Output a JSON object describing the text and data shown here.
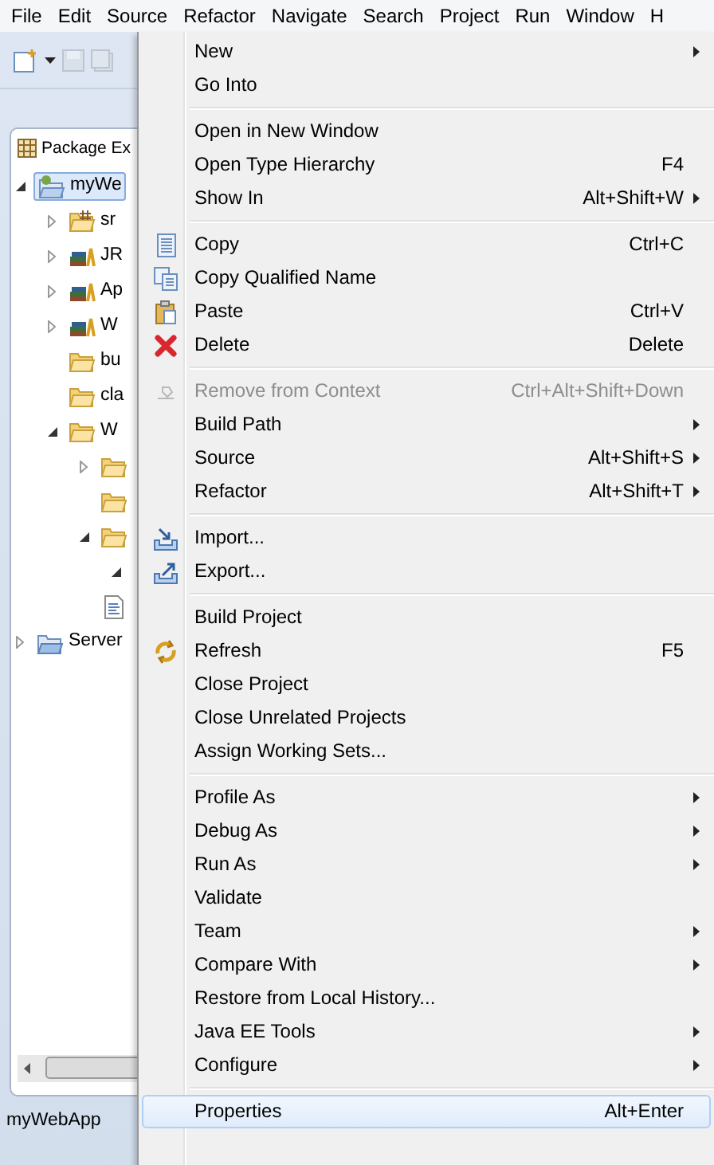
{
  "menubar": [
    "File",
    "Edit",
    "Source",
    "Refactor",
    "Navigate",
    "Search",
    "Project",
    "Run",
    "Window",
    "H"
  ],
  "explorer": {
    "title": "Package Ex",
    "tree": [
      {
        "label": "myWe",
        "kind": "project",
        "expanded": true,
        "selected": true,
        "children": [
          {
            "label": "sr",
            "kind": "package",
            "expanded": false,
            "selected": false
          },
          {
            "label": "JR",
            "kind": "library",
            "expanded": false,
            "selected": false
          },
          {
            "label": "Ap",
            "kind": "library",
            "expanded": false,
            "selected": false
          },
          {
            "label": "W",
            "kind": "library",
            "expanded": false,
            "selected": false
          },
          {
            "label": "bu",
            "kind": "folder",
            "selected": false
          },
          {
            "label": "cla",
            "kind": "folder",
            "selected": false
          },
          {
            "label": "W",
            "kind": "folder",
            "expanded": true,
            "selected": false,
            "children": [
              {
                "kind": "folder",
                "expanded": false,
                "selected": false
              },
              {
                "kind": "folder",
                "selected": false
              },
              {
                "kind": "folder",
                "expanded": true,
                "selected": false,
                "children": [
                  {
                    "expanded": true,
                    "selected": false
                  }
                ]
              },
              {
                "kind": "file",
                "selected": false
              }
            ]
          }
        ]
      },
      {
        "label": "Server",
        "kind": "servers",
        "expanded": false,
        "selected": false
      }
    ]
  },
  "status_bar": "myWebApp",
  "context_menu": [
    [
      {
        "label": "New",
        "submenu": true,
        "selected": false
      },
      {
        "label": "Go Into",
        "selected": false
      }
    ],
    [
      {
        "label": "Open in New Window",
        "selected": false
      },
      {
        "label": "Open Type Hierarchy",
        "shortcut": "F4",
        "selected": false
      },
      {
        "label": "Show In",
        "shortcut": "Alt+Shift+W",
        "submenu": true,
        "selected": false
      }
    ],
    [
      {
        "label": "Copy",
        "shortcut": "Ctrl+C",
        "kind": "copy",
        "selected": false
      },
      {
        "label": "Copy Qualified Name",
        "kind": "copy2",
        "selected": false
      },
      {
        "label": "Paste",
        "shortcut": "Ctrl+V",
        "kind": "paste",
        "selected": false
      },
      {
        "label": "Delete",
        "shortcut": "Delete",
        "kind": "delete",
        "selected": false
      }
    ],
    [
      {
        "label": "Remove from Context",
        "shortcut": "Ctrl+Alt+Shift+Down",
        "kind": "remove",
        "disabled": true,
        "selected": false
      },
      {
        "label": "Build Path",
        "submenu": true,
        "selected": false
      },
      {
        "label": "Source",
        "shortcut": "Alt+Shift+S",
        "submenu": true,
        "selected": false
      },
      {
        "label": "Refactor",
        "shortcut": "Alt+Shift+T",
        "submenu": true,
        "selected": false
      }
    ],
    [
      {
        "label": "Import...",
        "kind": "import",
        "selected": false
      },
      {
        "label": "Export...",
        "kind": "export",
        "selected": false
      }
    ],
    [
      {
        "label": "Build Project",
        "selected": false
      },
      {
        "label": "Refresh",
        "shortcut": "F5",
        "kind": "refresh",
        "selected": false
      },
      {
        "label": "Close Project",
        "selected": false
      },
      {
        "label": "Close Unrelated Projects",
        "selected": false
      },
      {
        "label": "Assign Working Sets...",
        "selected": false
      }
    ],
    [
      {
        "label": "Profile As",
        "submenu": true,
        "selected": false
      },
      {
        "label": "Debug As",
        "submenu": true,
        "selected": false
      },
      {
        "label": "Run As",
        "submenu": true,
        "selected": false
      },
      {
        "label": "Validate",
        "selected": false
      },
      {
        "label": "Team",
        "submenu": true,
        "selected": false
      },
      {
        "label": "Compare With",
        "submenu": true,
        "selected": false
      },
      {
        "label": "Restore from Local History...",
        "selected": false
      },
      {
        "label": "Java EE Tools",
        "submenu": true,
        "selected": false
      },
      {
        "label": "Configure",
        "submenu": true,
        "selected": false
      }
    ],
    [
      {
        "label": "Properties",
        "shortcut": "Alt+Enter",
        "selected": true
      }
    ]
  ]
}
